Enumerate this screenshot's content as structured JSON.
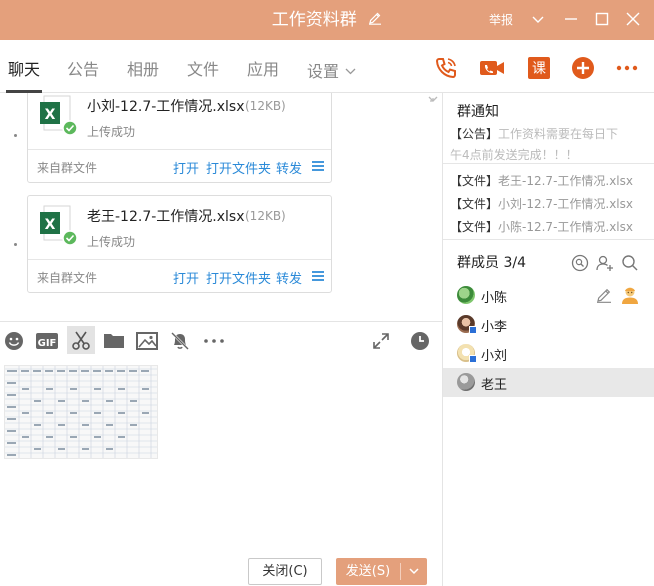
{
  "window": {
    "title": "工作资料群",
    "report": "举报"
  },
  "tabs": [
    {
      "label": "聊天",
      "active": true
    },
    {
      "label": "公告"
    },
    {
      "label": "相册"
    },
    {
      "label": "文件"
    },
    {
      "label": "应用"
    },
    {
      "label": "设置"
    }
  ],
  "chat": {
    "files": [
      {
        "name": "小刘-12.7-工作情况.xlsx",
        "size": "(12KB)",
        "status": "上传成功",
        "from": "来自群文件",
        "open": "打开",
        "open_folder": "打开文件夹",
        "forward": "转发"
      },
      {
        "name": "老王-12.7-工作情况.xlsx",
        "size": "(12KB)",
        "status": "上传成功",
        "from": "来自群文件",
        "open": "打开",
        "open_folder": "打开文件夹",
        "forward": "转发"
      }
    ]
  },
  "buttons": {
    "close": "关闭(C)",
    "send": "发送(S)"
  },
  "notice": {
    "title": "群通知",
    "tag": "【公告】",
    "text_line1": "工作资料需要在每日下",
    "text_line2": "午4点前发送完成！！！",
    "files": [
      {
        "tag": "【文件】",
        "name": "老王-12.7-工作情况.xlsx"
      },
      {
        "tag": "【文件】",
        "name": "小刘-12.7-工作情况.xlsx"
      },
      {
        "tag": "【文件】",
        "name": "小陈-12.7-工作情况.xlsx"
      }
    ]
  },
  "members": {
    "title": "群成员 3/4",
    "list": [
      {
        "name": "小陈"
      },
      {
        "name": "小李"
      },
      {
        "name": "小刘"
      },
      {
        "name": "老王"
      }
    ]
  },
  "colors": {
    "brand": "#e4a07c",
    "link": "#2b8ad8",
    "excel": "#1f7246",
    "success": "#5cb85c",
    "icon_orange": "#e05a1c"
  }
}
